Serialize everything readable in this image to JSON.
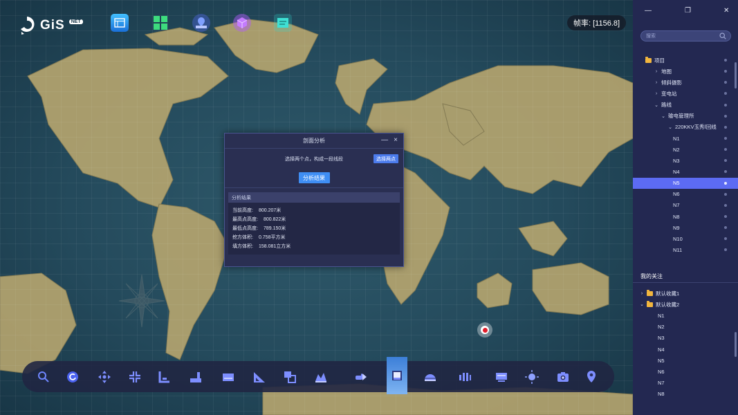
{
  "app": {
    "logo_text": "GiS",
    "logo_badge": "NET"
  },
  "fps": {
    "label": "帧率: [1156.8]"
  },
  "top_icons": [
    {
      "icon": "layers-panel-icon",
      "color": "#2ea8ff"
    },
    {
      "icon": "grid-apps-icon",
      "color": "#39d17a"
    },
    {
      "icon": "location-pin-icon",
      "color": "#5a8cff"
    },
    {
      "icon": "cube-3d-icon",
      "color": "#b25cff"
    },
    {
      "icon": "document-panel-icon",
      "color": "#2ed2c6"
    }
  ],
  "dialog": {
    "title": "剖面分析",
    "minimize": "—",
    "close": "×",
    "instruction": "选择两个点，构成一段线段",
    "select_button": "选择两点",
    "result_button": "分析结果",
    "result_title": "分析结果",
    "results": [
      {
        "label": "当前高度:",
        "value": "800.207米"
      },
      {
        "label": "最高点高度:",
        "value": "800.822米"
      },
      {
        "label": "最低点高度:",
        "value": "789.150米"
      },
      {
        "label": "挖方体积:",
        "value": "0.758平方米"
      },
      {
        "label": "填方体积:",
        "value": "158.081立方米"
      }
    ]
  },
  "panel": {
    "window_controls": {
      "minimize": "—",
      "restore": "❐",
      "close": "✕"
    },
    "search_placeholder": "搜索",
    "tree": [
      {
        "label": "项目",
        "level": 0,
        "type": "folder"
      },
      {
        "label": "地图",
        "level": 1,
        "arrow": "›"
      },
      {
        "label": "倾斜摄影",
        "level": 1,
        "arrow": "›"
      },
      {
        "label": "变电站",
        "level": 1,
        "arrow": "›"
      },
      {
        "label": "路线",
        "level": 1,
        "arrow": "⌄"
      },
      {
        "label": "输电管理所",
        "level": 2,
        "arrow": "⌄"
      },
      {
        "label": "220KKV玉秀Ⅰ回线",
        "level": 3,
        "arrow": "⌄"
      },
      {
        "label": "N1",
        "level": 4
      },
      {
        "label": "N2",
        "level": 4
      },
      {
        "label": "N3",
        "level": 4
      },
      {
        "label": "N4",
        "level": 4
      },
      {
        "label": "N5",
        "level": 4,
        "selected": true
      },
      {
        "label": "N6",
        "level": 4
      },
      {
        "label": "N7",
        "level": 4
      },
      {
        "label": "N8",
        "level": 4
      },
      {
        "label": "N9",
        "level": 4
      },
      {
        "label": "N10",
        "level": 4
      },
      {
        "label": "N11",
        "level": 4
      }
    ],
    "favorites_title": "我的关注",
    "favorites": [
      {
        "label": "默认收藏1",
        "level": 0,
        "arrow": "›",
        "type": "folder"
      },
      {
        "label": "默认收藏2",
        "level": 0,
        "arrow": "⌄",
        "type": "folder"
      },
      {
        "label": "N1",
        "level": 1
      },
      {
        "label": "N2",
        "level": 1
      },
      {
        "label": "N3",
        "level": 1
      },
      {
        "label": "N4",
        "level": 1
      },
      {
        "label": "N5",
        "level": 1
      },
      {
        "label": "N6",
        "level": 1
      },
      {
        "label": "N7",
        "level": 1
      },
      {
        "label": "N8",
        "level": 1
      }
    ]
  },
  "bottom_tools": [
    {
      "icon": "zoom-search-icon"
    },
    {
      "icon": "refresh-icon"
    },
    {
      "icon": "pan-move-icon"
    },
    {
      "icon": "fullscreen-icon"
    },
    {
      "icon": "distance-measure-icon"
    },
    {
      "icon": "height-measure-icon"
    },
    {
      "icon": "area-measure-icon"
    },
    {
      "icon": "angle-measure-icon"
    },
    {
      "icon": "overlay-analysis-icon"
    },
    {
      "icon": "terrain-analysis-icon"
    },
    {
      "icon": "flood-analysis-icon"
    },
    {
      "icon": "profile-analysis-icon",
      "active": true
    },
    {
      "icon": "dome-analysis-icon"
    },
    {
      "icon": "buffer-analysis-icon"
    },
    {
      "icon": "monitor-icon"
    },
    {
      "icon": "sun-light-icon"
    },
    {
      "icon": "camera-screenshot-icon"
    },
    {
      "icon": "location-marker-icon"
    }
  ]
}
